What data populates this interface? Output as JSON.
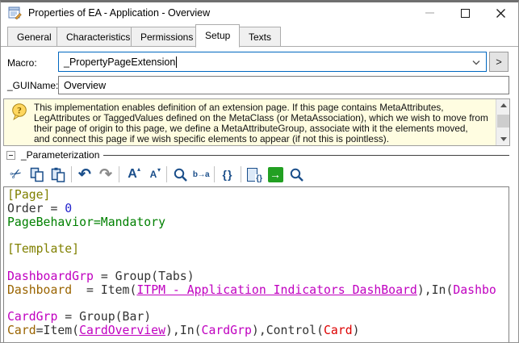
{
  "window": {
    "title": "Properties of EA - Application - Overview"
  },
  "tabs": [
    {
      "label": "General",
      "active": false
    },
    {
      "label": "Characteristics",
      "active": false
    },
    {
      "label": "Permissions",
      "active": false
    },
    {
      "label": "Setup",
      "active": true
    },
    {
      "label": "Texts",
      "active": false
    }
  ],
  "macro": {
    "label": "Macro:",
    "value": "_PropertyPageExtension",
    "expand_button": ">"
  },
  "guiname": {
    "label": "_GUIName:",
    "value": "Overview"
  },
  "info_box": {
    "lines": [
      "This implementation enables definition of an extension page. If this page contains MetaAttributes,",
      "LegAttributes or TaggedValues defined on the MetaClass (or MetaAssociation), which we wish to move from",
      "their page of origin to this page, we define a MetaAttributeGroup, associate with it the elements moved,",
      "and connect this page if we wish specific elements to appear (if not this is pointless)."
    ]
  },
  "parameterization": {
    "label": "_Parameterization"
  },
  "toolbar": {
    "icon_color": "#1a4e8a",
    "go_color": "#22a022",
    "icons": [
      {
        "name": "cut",
        "glyph": "✂"
      },
      {
        "name": "copy"
      },
      {
        "name": "paste"
      },
      {
        "name": "undo",
        "glyph": "↶"
      },
      {
        "name": "redo",
        "glyph": "↷"
      },
      {
        "name": "font-increase",
        "glyph": "A",
        "arrow": "▴"
      },
      {
        "name": "font-decrease",
        "glyph": "A",
        "arrow": "▾"
      },
      {
        "name": "zoom"
      },
      {
        "name": "replace",
        "glyph": "b→a"
      },
      {
        "name": "braces",
        "glyph": "{}"
      },
      {
        "name": "paste-braces",
        "glyph": "{}"
      },
      {
        "name": "go",
        "glyph": "→"
      },
      {
        "name": "search"
      }
    ]
  },
  "editor": {
    "colors": {
      "default": "#333333",
      "section": "#808000",
      "number": "#2222cc",
      "green": "#008000",
      "magenta": "#c000c0",
      "brown": "#9a6400",
      "red": "#dd0000"
    },
    "lines": [
      [
        {
          "t": "[Page]",
          "c": "section"
        }
      ],
      [
        {
          "t": "Order = ",
          "c": "default"
        },
        {
          "t": "0",
          "c": "number"
        }
      ],
      [
        {
          "t": "PageBehavior=Mandatory",
          "c": "green"
        }
      ],
      [],
      [
        {
          "t": "[Template]",
          "c": "section"
        }
      ],
      [],
      [
        {
          "t": "DashboardGrp",
          "c": "magenta"
        },
        {
          "t": " = Group(Tabs)",
          "c": "default"
        }
      ],
      [
        {
          "t": "Dashboard",
          "c": "brown"
        },
        {
          "t": "  = Item(",
          "c": "default"
        },
        {
          "t": "ITPM - Application Indicators DashBoard",
          "c": "magenta",
          "u": true
        },
        {
          "t": "),In(",
          "c": "default"
        },
        {
          "t": "Dashbo",
          "c": "magenta"
        }
      ],
      [],
      [
        {
          "t": "CardGrp",
          "c": "magenta"
        },
        {
          "t": " = Group(Bar)",
          "c": "default"
        }
      ],
      [
        {
          "t": "Card",
          "c": "brown"
        },
        {
          "t": "=Item(",
          "c": "default"
        },
        {
          "t": "CardOverview",
          "c": "magenta",
          "u": true
        },
        {
          "t": "),In(",
          "c": "default"
        },
        {
          "t": "CardGrp",
          "c": "magenta"
        },
        {
          "t": "),Control(",
          "c": "default"
        },
        {
          "t": "Card",
          "c": "red"
        },
        {
          "t": ")",
          "c": "default"
        }
      ]
    ]
  }
}
